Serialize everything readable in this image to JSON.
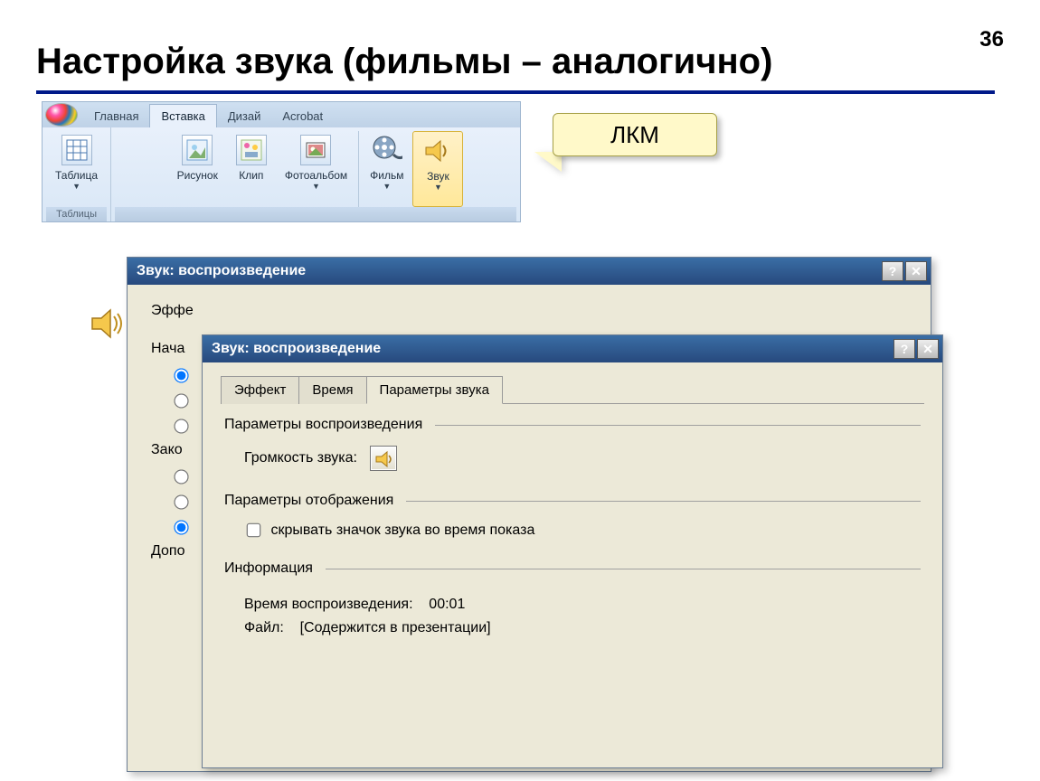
{
  "slide": {
    "title": "Настройка звука (фильмы – аналогично)",
    "number": "36"
  },
  "callout": {
    "text": "ЛКМ"
  },
  "ribbon": {
    "tabs": {
      "home": "Главная",
      "insert": "Вставка",
      "design": "Дизай",
      "acrobat": "Acrobat"
    },
    "items": {
      "table": "Таблица",
      "picture": "Рисунок",
      "clip": "Клип",
      "album": "Фотоальбом",
      "movie": "Фильм",
      "sound": "Звук"
    },
    "group_tables": "Таблицы"
  },
  "dialog1": {
    "title": "Звук: воспроизведение",
    "labels": {
      "effect_prefix": "Эффе",
      "start_prefix": "Нача",
      "end_prefix": "Зако",
      "extra_prefix": "Допо"
    }
  },
  "dialog2": {
    "title": "Звук: воспроизведение",
    "tabs": {
      "effect": "Эффект",
      "time": "Время",
      "params": "Параметры звука"
    },
    "groups": {
      "playback": "Параметры воспроизведения",
      "display": "Параметры отображения",
      "info": "Информация"
    },
    "volume_label": "Громкость звука:",
    "hide_icon_label": "скрывать значок звука во время показа",
    "info_time_label": "Время воспроизведения:",
    "info_time_value": "00:01",
    "info_file_label": "Файл:",
    "info_file_value": "[Содержится в презентации]"
  }
}
